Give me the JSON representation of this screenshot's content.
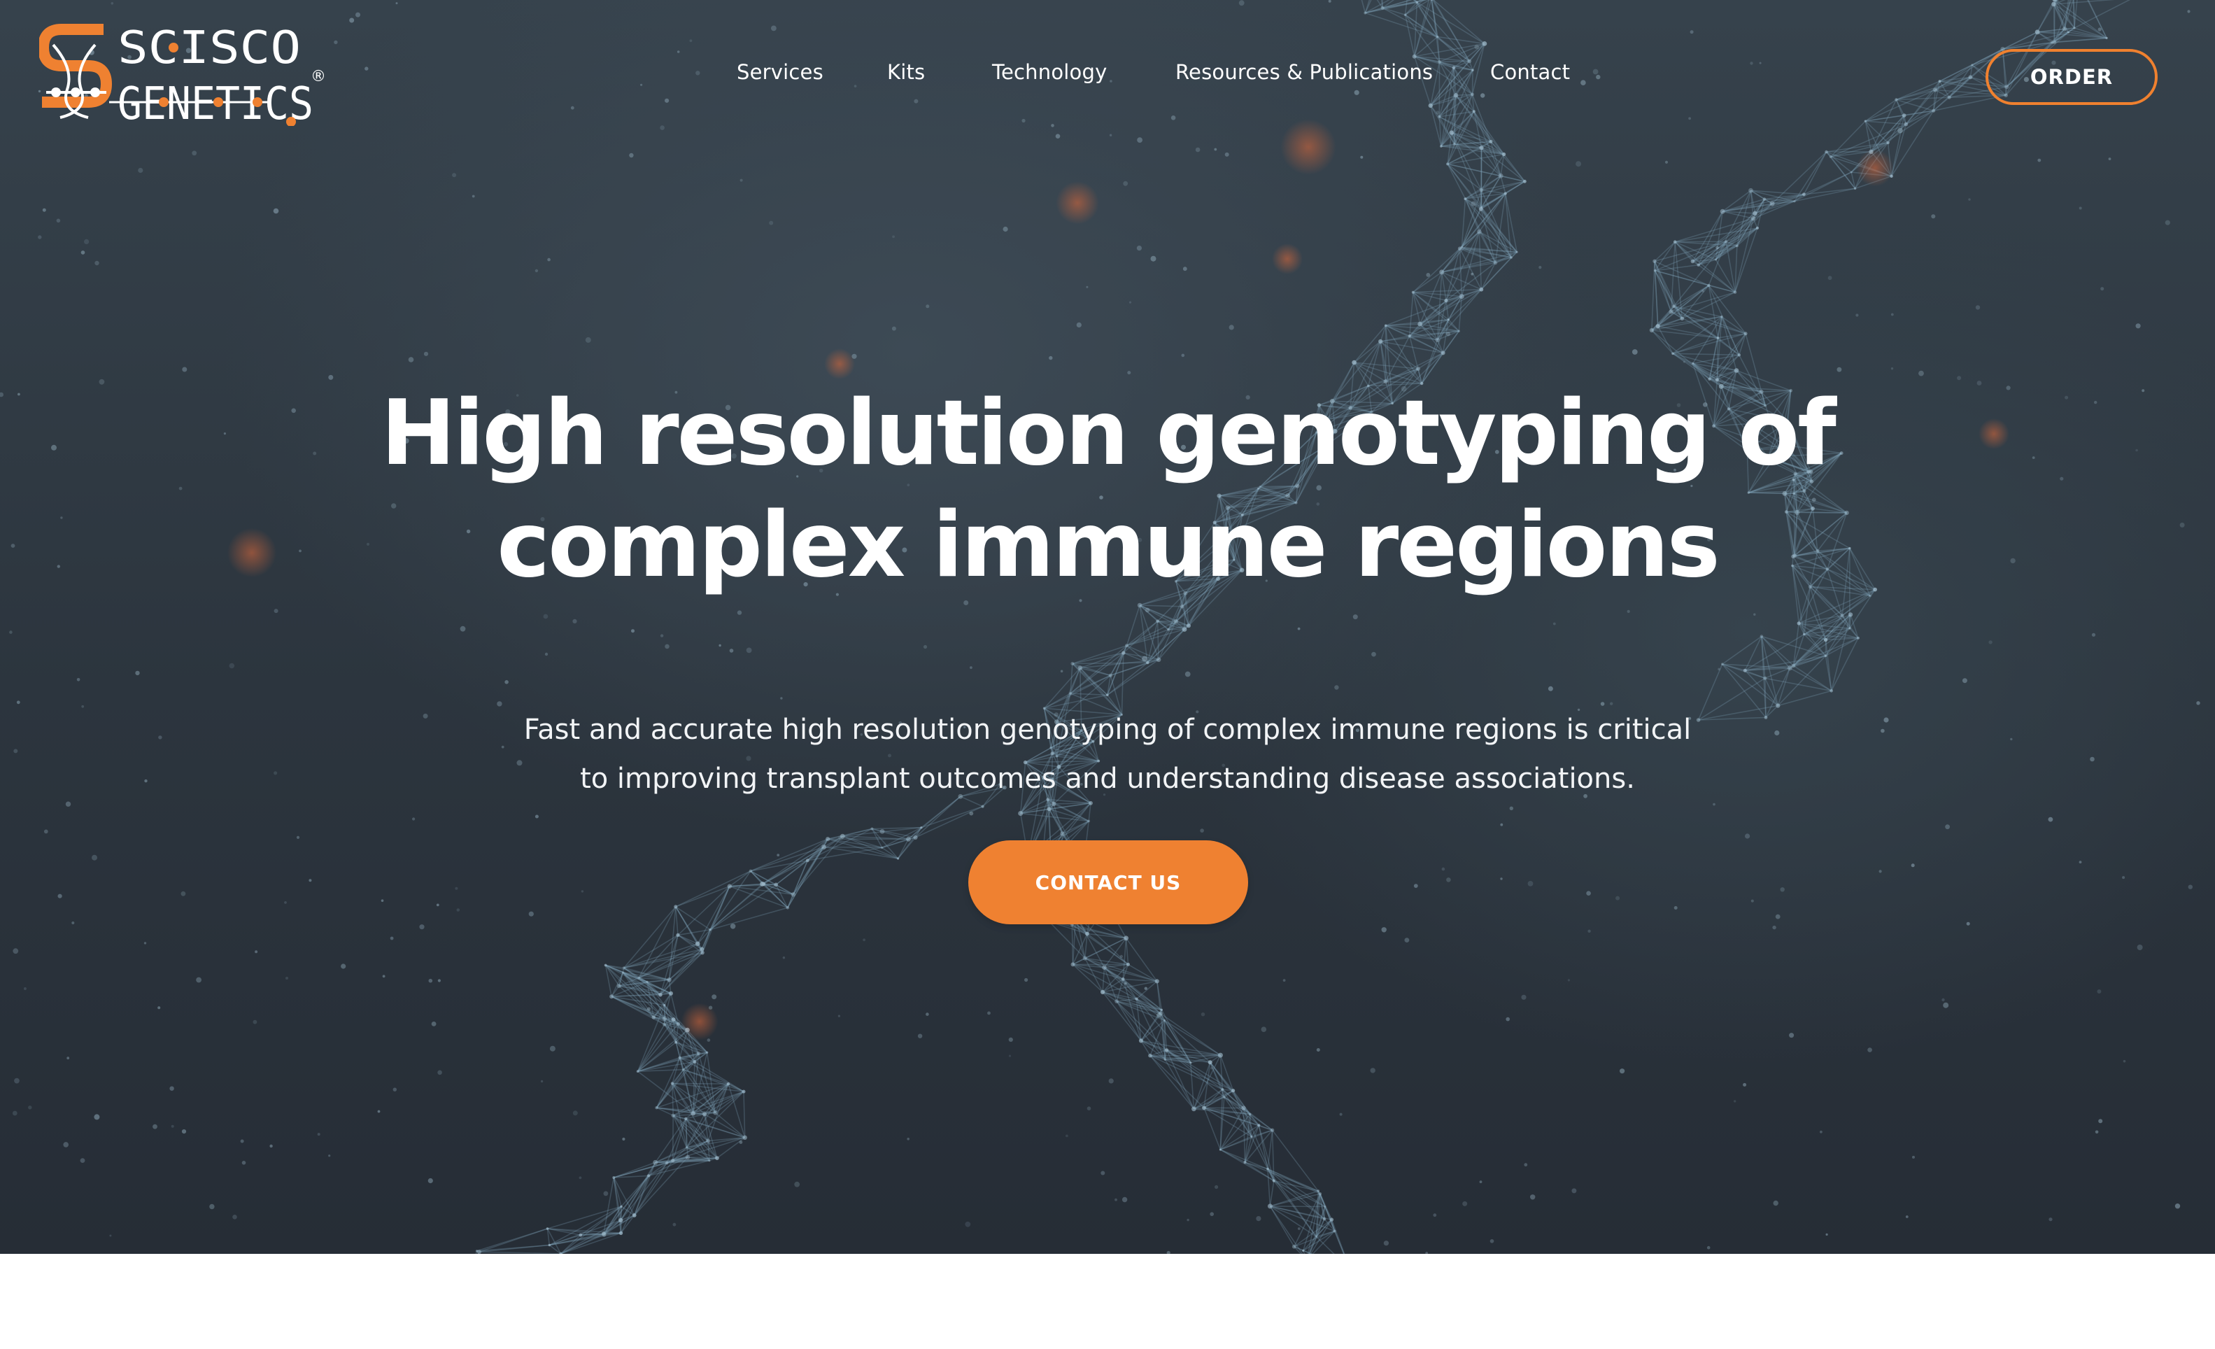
{
  "brand": {
    "name_line1": "SCISCO",
    "name_line2": "GENETICS",
    "registered_mark": "®",
    "accent_color": "#ef8131",
    "logo_icon": "dna-helix-logo-icon"
  },
  "nav": {
    "items": [
      {
        "label": "Services"
      },
      {
        "label": "Kits"
      },
      {
        "label": "Technology"
      },
      {
        "label": "Resources & Publications"
      },
      {
        "label": "Contact"
      }
    ],
    "order_label": "ORDER"
  },
  "hero": {
    "headline_line1": "High resolution genotyping of",
    "headline_line2": "complex immune regions",
    "subtext_line1": "Fast and accurate high resolution genotyping of complex immune regions is critical",
    "subtext_line2": "to improving transplant outcomes and understanding disease associations.",
    "cta_label": "CONTACT US",
    "background": "dna-network-illustration"
  }
}
